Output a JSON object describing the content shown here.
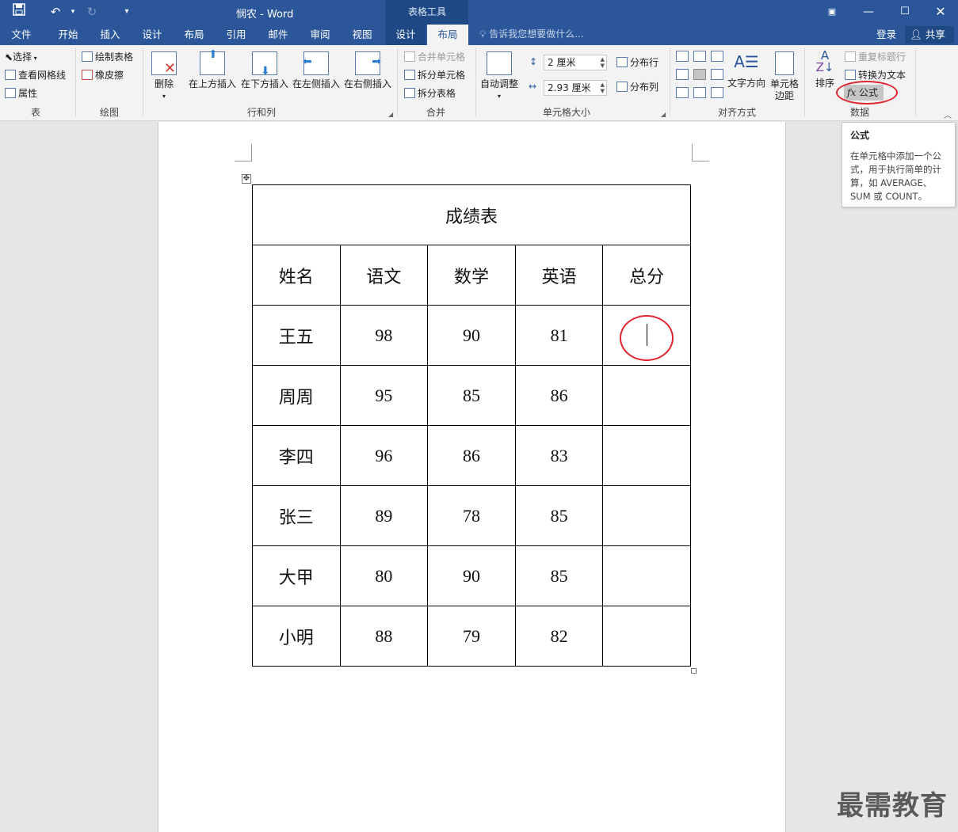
{
  "titlebar": {
    "doc_title": "悯农 - Word",
    "context_header": "表格工具",
    "qat": {
      "save_icon": "save-icon",
      "undo_icon": "undo-icon",
      "redo_icon": "redo-icon",
      "customize_icon": "customize-qat-icon"
    }
  },
  "tabs": [
    "文件",
    "开始",
    "插入",
    "设计",
    "布局",
    "引用",
    "邮件",
    "审阅",
    "视图"
  ],
  "context_tabs": [
    "设计",
    "布局"
  ],
  "active_tab": "布局",
  "tell_me": "告诉我您想要做什么...",
  "signin": "登录",
  "share": "共享",
  "ribbon": {
    "table_group": {
      "label": "表",
      "select": "选择",
      "gridlines": "查看网格线",
      "properties": "属性"
    },
    "draw_group": {
      "label": "绘图",
      "draw_table": "绘制表格",
      "eraser": "橡皮擦"
    },
    "rows_cols_group": {
      "label": "行和列",
      "delete": "删除",
      "insert_above": "在上方插入",
      "insert_below": "在下方插入",
      "insert_left": "在左侧插入",
      "insert_right": "在右侧插入"
    },
    "merge_group": {
      "label": "合并",
      "merge_cells": "合并单元格",
      "split_cells": "拆分单元格",
      "split_table": "拆分表格"
    },
    "cell_size_group": {
      "label": "单元格大小",
      "autofit": "自动调整",
      "height_value": "2 厘米",
      "width_value": "2.93 厘米",
      "distribute_rows": "分布行",
      "distribute_cols": "分布列"
    },
    "alignment_group": {
      "label": "对齐方式",
      "text_direction": "文字方向",
      "cell_margins_line1": "单元格",
      "cell_margins_line2": "边距"
    },
    "data_group": {
      "label": "数据",
      "sort": "排序",
      "repeat_header": "重复标题行",
      "convert_to_text": "转换为文本",
      "formula": "公式"
    }
  },
  "tooltip": {
    "title": "公式",
    "description": "在单元格中添加一个公式，用于执行简单的计算，如 AVERAGE、SUM 或 COUNT。"
  },
  "table": {
    "title": "成绩表",
    "headers": [
      "姓名",
      "语文",
      "数学",
      "英语",
      "总分"
    ],
    "rows": [
      [
        "王五",
        "98",
        "90",
        "81",
        ""
      ],
      [
        "周周",
        "95",
        "85",
        "86",
        ""
      ],
      [
        "李四",
        "96",
        "86",
        "83",
        ""
      ],
      [
        "张三",
        "89",
        "78",
        "85",
        ""
      ],
      [
        "大甲",
        "80",
        "90",
        "85",
        ""
      ],
      [
        "小明",
        "88",
        "79",
        "82",
        ""
      ]
    ]
  },
  "watermark": "最需教育"
}
